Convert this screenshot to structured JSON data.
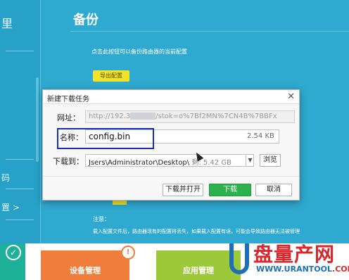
{
  "page": {
    "title": "备份",
    "description": "点击此按钮可以备份路由器的当前配置",
    "export_button": "导出配置",
    "notice_title": "注意：",
    "notice_text": "载入配置文件后，路由器现有的配置将丢失，如果载入配置有误，可能会导致路由器无法被管理"
  },
  "left_panel": {
    "glyphs": [
      "里",
      "码",
      "置 >"
    ]
  },
  "bottom_tiles": [
    {
      "label": "设备管理",
      "badge": "!"
    },
    {
      "label": "应用管理"
    }
  ],
  "dialog": {
    "title": "新建下载任务",
    "url_label": "网址：",
    "url_value_start": "http://192.3",
    "url_value_end": "/stok=o%7Bf2MN%7CN4B%7BBFx",
    "name_label": "名称：",
    "name_value": "config.bin",
    "name_size": "2.54 KB",
    "download_to_label": "下载到：",
    "path_value": "Jsers\\Administrator\\Desktop\\",
    "path_free": "剩: 5.42 GB",
    "browse_button": "浏览",
    "download_open_button": "下载并打开",
    "download_button": "下载",
    "cancel_button": "取消"
  },
  "watermark": {
    "brand_cn": "盘量产网",
    "url_part1": "WWW.URANTOOL",
    "url_part2": ".COM"
  },
  "colors": {
    "background": "#2fa9cf",
    "export_button": "#f2e32a",
    "download_button": "#2bb24c",
    "highlight_box": "#1a2fb8",
    "tile_orange": "#f07d3c",
    "tile_green": "#9cc93a",
    "tile_teal": "#1fb09a"
  }
}
